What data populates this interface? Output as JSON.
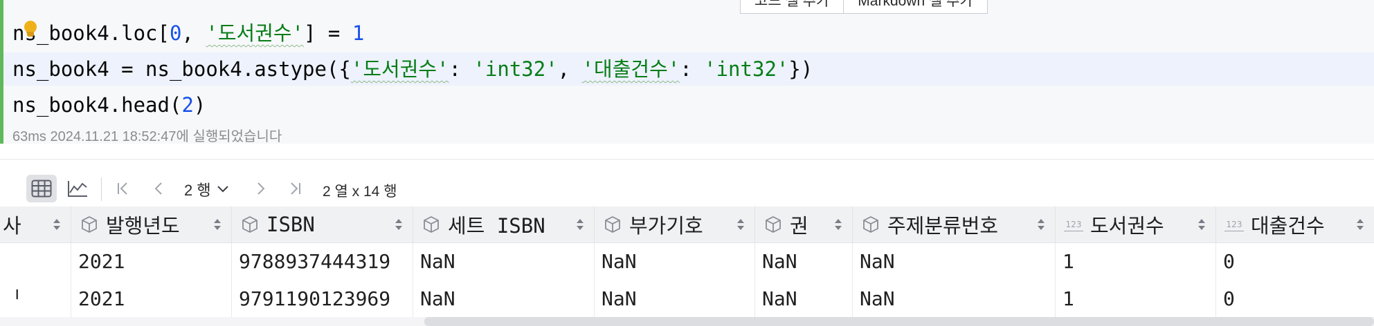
{
  "cell": {
    "line1": {
      "a": "ns_book4.loc[",
      "n0": "0",
      "comma": ", ",
      "s1": "'도서권수'",
      "b": "] = ",
      "n1": "1"
    },
    "line2": {
      "a": "ns_book4 = ns_book4.astype({",
      "s1": "'도서권수'",
      "c1": ": ",
      "s2": "'int32'",
      "c2": ", ",
      "s3": "'대출건수'",
      "c3": ": ",
      "s4": "'int32'",
      "b": "})"
    },
    "line3": {
      "a": "ns_book4.head(",
      "n": "2",
      "b": ")"
    },
    "exec_info": "63ms 2024.11.21 18:52:47에 실행되었습니다",
    "add_code_label": "코드 셀 추가",
    "add_markdown_label": "Markdown 셀 추가",
    "accent_color": "#5fb85a"
  },
  "toolbar": {
    "table_view_icon": "table-icon",
    "chart_view_icon": "chart-icon",
    "rows_value": "2 행",
    "shape": "2 열 x 14 행"
  },
  "table": {
    "columns": [
      {
        "label": "사",
        "type": "none"
      },
      {
        "label": "발행년도",
        "type": "object"
      },
      {
        "label": "ISBN",
        "type": "object"
      },
      {
        "label": "세트 ISBN",
        "type": "object"
      },
      {
        "label": "부가기호",
        "type": "object"
      },
      {
        "label": "권",
        "type": "object"
      },
      {
        "label": "주제분류번호",
        "type": "object"
      },
      {
        "label": "도서권수",
        "type": "numeric"
      },
      {
        "label": "대출건수",
        "type": "numeric"
      }
    ],
    "rows": [
      [
        "",
        "2021",
        "9788937444319",
        "NaN",
        "NaN",
        "NaN",
        "NaN",
        "1",
        "0"
      ],
      [
        "ᅵ",
        "2021",
        "9791190123969",
        "NaN",
        "NaN",
        "NaN",
        "NaN",
        "1",
        "0"
      ]
    ],
    "numeric_icon_text": "123"
  }
}
